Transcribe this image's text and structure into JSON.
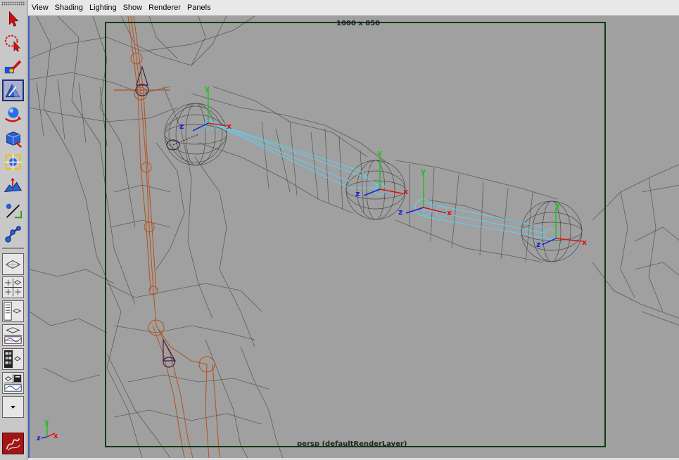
{
  "menu": [
    "View",
    "Shading",
    "Lighting",
    "Show",
    "Renderer",
    "Panels"
  ],
  "viewport": {
    "resolution_label": "1000 x 050",
    "camera_label": "persp (defaultRenderLayer)"
  },
  "axis_labels": {
    "y": "y",
    "z": "z",
    "x": "x"
  },
  "tools": [
    {
      "name": "select-tool",
      "icon": "arrow-icon"
    },
    {
      "name": "lasso-tool",
      "icon": "lasso-icon"
    },
    {
      "name": "paint-select-tool",
      "icon": "paint-brush-icon"
    },
    {
      "name": "move-tool",
      "icon": "move-icon",
      "active": true
    },
    {
      "name": "rotate-tool",
      "icon": "rotate-icon"
    },
    {
      "name": "scale-tool",
      "icon": "scale-icon"
    },
    {
      "name": "universal-manipulator-tool",
      "icon": "universal-manip-icon"
    },
    {
      "name": "soft-modification-tool",
      "icon": "soft-mod-icon"
    },
    {
      "name": "show-manipulator-tool",
      "icon": "show-manip-icon"
    },
    {
      "name": "joint-tool",
      "icon": "joint-icon"
    }
  ],
  "colors": {
    "viewport_bg": "#a0a0a0",
    "wireframe": "#5a5a5a",
    "skeleton": "#b5511a",
    "selected_joints": "#5fd0f0",
    "resolution_gate": "#0b3d16",
    "axis_x": "#e01010",
    "axis_y": "#20c020",
    "axis_z": "#1020e0"
  }
}
